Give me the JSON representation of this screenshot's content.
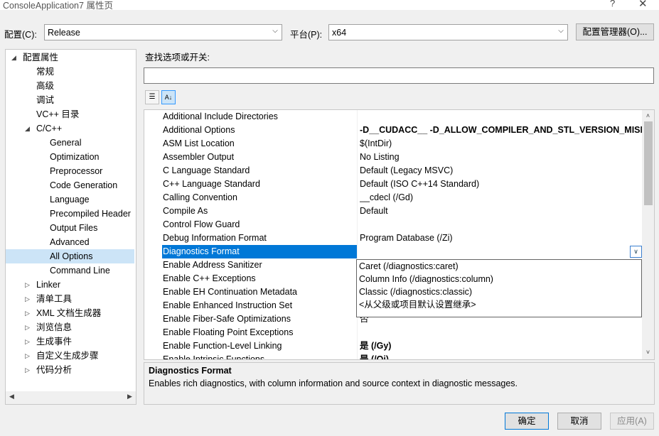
{
  "window": {
    "title": "ConsoleApplication7 属性页",
    "help_glyph": "?",
    "close_glyph": "✕"
  },
  "config_row": {
    "config_label": "配置(C):",
    "config_value": "Release",
    "platform_label": "平台(P):",
    "platform_value": "x64",
    "manager_button": "配置管理器(O)..."
  },
  "tree": {
    "items": [
      {
        "label": "配置属性",
        "twisty": "◢"
      },
      {
        "label": "常规"
      },
      {
        "label": "高级"
      },
      {
        "label": "调试"
      },
      {
        "label": "VC++ 目录"
      },
      {
        "label": "C/C++",
        "twisty": "◢"
      },
      {
        "label": "General"
      },
      {
        "label": "Optimization"
      },
      {
        "label": "Preprocessor"
      },
      {
        "label": "Code Generation"
      },
      {
        "label": "Language"
      },
      {
        "label": "Precompiled Header"
      },
      {
        "label": "Output Files"
      },
      {
        "label": "Advanced"
      },
      {
        "label": "All Options",
        "selected": true
      },
      {
        "label": "Command Line"
      },
      {
        "label": "Linker",
        "twisty": "▷"
      },
      {
        "label": "清单工具",
        "twisty": "▷"
      },
      {
        "label": "XML 文档生成器",
        "twisty": "▷"
      },
      {
        "label": "浏览信息",
        "twisty": "▷"
      },
      {
        "label": "生成事件",
        "twisty": "▷"
      },
      {
        "label": "自定义生成步骤",
        "twisty": "▷"
      },
      {
        "label": "代码分析",
        "twisty": "▷"
      }
    ]
  },
  "search": {
    "label": "查找选项或开关:",
    "value": ""
  },
  "toolbar": {
    "categorized_icon": "categorized-view-icon",
    "alphabetical_icon": "alphabetical-sort-icon"
  },
  "grid": {
    "rows": [
      {
        "name": "Additional Include Directories",
        "value": ""
      },
      {
        "name": "Additional Options",
        "value": "-D__CUDACC__ -D_ALLOW_COMPILER_AND_STL_VERSION_MISMATCH",
        "bold": true
      },
      {
        "name": "ASM List Location",
        "value": "$(IntDir)"
      },
      {
        "name": "Assembler Output",
        "value": "No Listing"
      },
      {
        "name": "C Language Standard",
        "value": "Default (Legacy MSVC)"
      },
      {
        "name": "C++ Language Standard",
        "value": "Default (ISO C++14 Standard)"
      },
      {
        "name": "Calling Convention",
        "value": "__cdecl (/Gd)"
      },
      {
        "name": "Compile As",
        "value": "Default"
      },
      {
        "name": "Control Flow Guard",
        "value": ""
      },
      {
        "name": "Debug Information Format",
        "value": "Program Database (/Zi)"
      },
      {
        "name": "Diagnostics Format",
        "value": "",
        "selected": true
      },
      {
        "name": "Enable Address Sanitizer",
        "value": ""
      },
      {
        "name": "Enable C++ Exceptions",
        "value": ""
      },
      {
        "name": "Enable EH Continuation Metadata",
        "value": ""
      },
      {
        "name": "Enable Enhanced Instruction Set",
        "value": ""
      },
      {
        "name": "Enable Fiber-Safe Optimizations",
        "value": "否"
      },
      {
        "name": "Enable Floating Point Exceptions",
        "value": ""
      },
      {
        "name": "Enable Function-Level Linking",
        "value": "是 (/Gy)",
        "bold": true
      },
      {
        "name": "Enable Intrinsic Functions",
        "value": "是 (/Oi)",
        "bold": true
      }
    ]
  },
  "dropdown": {
    "options": [
      "Caret (/diagnostics:caret)",
      "Column Info (/diagnostics:column)",
      "Classic (/diagnostics:classic)",
      "<从父级或项目默认设置继承>"
    ]
  },
  "description": {
    "title": "Diagnostics Format",
    "text": "Enables rich diagnostics, with column information and source context in diagnostic messages."
  },
  "buttons": {
    "ok": "确定",
    "cancel": "取消",
    "apply": "应用(A)"
  },
  "colors": {
    "selection": "#0078d7",
    "tree_selection": "#cce4f7"
  }
}
